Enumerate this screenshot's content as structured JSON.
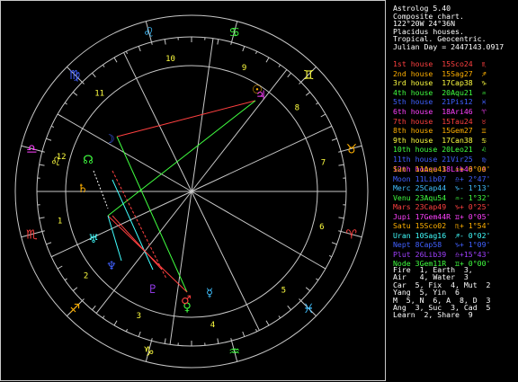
{
  "info_lines": [
    "Astrolog 5.40",
    "Composite chart.",
    "122°20W 24°36N",
    "Placidus houses.",
    "Tropical. Geocentric.",
    "Julian Day = 2447143.0917"
  ],
  "houses": [
    {
      "label": "1st house",
      "pos": "15Sco24",
      "glyph": "♏",
      "color": "#ff4040"
    },
    {
      "label": "2nd house",
      "pos": "15Sag27",
      "glyph": "♐",
      "color": "#ffb000"
    },
    {
      "label": "3rd house",
      "pos": "17Cap38",
      "glyph": "♑",
      "color": "#ffff40"
    },
    {
      "label": "4th house",
      "pos": "20Aqu21",
      "glyph": "♒",
      "color": "#40ff40"
    },
    {
      "label": "5th house",
      "pos": "21Pis12",
      "glyph": "♓",
      "color": "#4060ff"
    },
    {
      "label": "6th house",
      "pos": "18Ari46",
      "glyph": "♈",
      "color": "#ff40ff"
    },
    {
      "label": "7th house",
      "pos": "15Tau24",
      "glyph": "♉",
      "color": "#ff4040"
    },
    {
      "label": "8th house",
      "pos": "15Gem27",
      "glyph": "♊",
      "color": "#ffb000"
    },
    {
      "label": "9th house",
      "pos": "17Can38",
      "glyph": "♋",
      "color": "#ffff40"
    },
    {
      "label": "10th house",
      "pos": "20Leo21",
      "glyph": "♌",
      "color": "#40ff40"
    },
    {
      "label": "11th house",
      "pos": "21Vir25",
      "glyph": "♍",
      "color": "#4060ff"
    },
    {
      "label": "12th house",
      "pos": "18Lib46",
      "glyph": "♎",
      "color": "#ff40ff"
    }
  ],
  "planets": [
    {
      "name": "Sun",
      "pos": "11Aqu43",
      "lat": "+ 0°00'",
      "glyph": "♒",
      "color": "#ffb000"
    },
    {
      "name": "Moon",
      "pos": "11Lib07",
      "lat": "+ 2°47'",
      "glyph": "♎",
      "color": "#4060ff"
    },
    {
      "name": "Merc",
      "pos": "25Cap44",
      "lat": "- 1°13'",
      "glyph": "♑",
      "color": "#40c0ff"
    },
    {
      "name": "Venu",
      "pos": "23Aqu54",
      "lat": "- 1°32'",
      "glyph": "♒",
      "color": "#40ff40"
    },
    {
      "name": "Mars",
      "pos": "23Cap49",
      "lat": "+ 0°25'",
      "glyph": "♑",
      "color": "#ff4040"
    },
    {
      "name": "Jupi",
      "pos": "17Gem44R",
      "lat": "+ 0°05'",
      "glyph": "♊",
      "color": "#ff40ff"
    },
    {
      "name": "Satu",
      "pos": "15Sco02",
      "lat": "+ 1°54'",
      "glyph": "♏",
      "color": "#ffb000"
    },
    {
      "name": "Uran",
      "pos": "10Sag16",
      "lat": "- 0°02'",
      "glyph": "♐",
      "color": "#40ffff"
    },
    {
      "name": "Nept",
      "pos": "8Cap58",
      "lat": "+ 1°09'",
      "glyph": "♑",
      "color": "#4060ff"
    },
    {
      "name": "Plut",
      "pos": "26Lib39",
      "lat": "+15°43'",
      "glyph": "♎",
      "color": "#a040ff"
    },
    {
      "name": "Node",
      "pos": "3Gem11R",
      "lat": "+ 0°00'",
      "glyph": "♊",
      "color": "#40ff40"
    }
  ],
  "summary_lines": [
    "Fire  1, Earth  3,",
    "Air   4, Water  3",
    "Car  5, Fix  4, Mut  2",
    "Yang  5, Yin  6",
    "M  5, N  6, A  8, D  3",
    "Ang  3, Suc  3, Cad  5",
    "Learn  2, Share  9"
  ],
  "wheel": {
    "house_numbers": [
      "1",
      "2",
      "3",
      "4",
      "5",
      "6",
      "7",
      "8",
      "9",
      "10",
      "11",
      "12"
    ],
    "signs": [
      {
        "glyph": "♈",
        "color": "#ff4040"
      },
      {
        "glyph": "♉",
        "color": "#ffb000"
      },
      {
        "glyph": "♊",
        "color": "#ffff40"
      },
      {
        "glyph": "♋",
        "color": "#40ff40"
      },
      {
        "glyph": "♌",
        "color": "#40c0ff"
      },
      {
        "glyph": "♍",
        "color": "#4060ff"
      },
      {
        "glyph": "♎",
        "color": "#ff40ff"
      },
      {
        "glyph": "♏",
        "color": "#ff4040"
      },
      {
        "glyph": "♐",
        "color": "#ffb000"
      },
      {
        "glyph": "♑",
        "color": "#ffff40"
      },
      {
        "glyph": "♒",
        "color": "#40ff40"
      },
      {
        "glyph": "♓",
        "color": "#40c0ff"
      }
    ],
    "planet_glyphs": [
      {
        "glyph": "☉",
        "color": "#ffb000"
      },
      {
        "glyph": "☽",
        "color": "#4060ff"
      },
      {
        "glyph": "☿",
        "color": "#40c0ff"
      },
      {
        "glyph": "♀",
        "color": "#40ff40"
      },
      {
        "glyph": "♂",
        "color": "#ff4040"
      },
      {
        "glyph": "♃",
        "color": "#ff40ff"
      },
      {
        "glyph": "♄",
        "color": "#ffb000"
      },
      {
        "glyph": "♅",
        "color": "#40ffff"
      },
      {
        "glyph": "♆",
        "color": "#4060ff"
      },
      {
        "glyph": "♇",
        "color": "#a040ff"
      },
      {
        "glyph": "☊",
        "color": "#40ff40"
      },
      {
        "glyph": "♌",
        "color": "#ffff40"
      }
    ]
  }
}
